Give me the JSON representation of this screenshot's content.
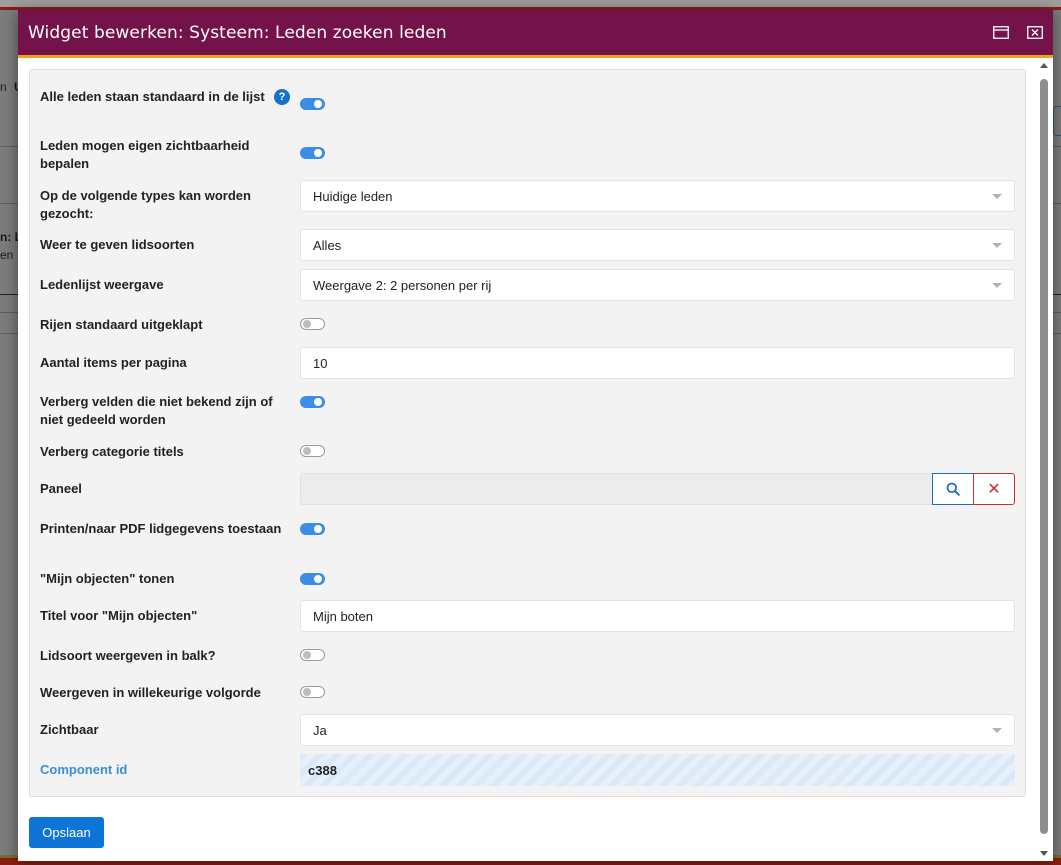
{
  "background": {
    "text_1": "n",
    "text_2": "U",
    "text_3": "n: L",
    "text_4": "en"
  },
  "modal": {
    "title": "Widget bewerken: Systeem: Leden zoeken leden",
    "maximize_icon": "window-maximize-icon",
    "close_icon": "window-close-icon"
  },
  "form": {
    "all_members_default": {
      "label": "Alle leden staan standaard in de lijst",
      "help": "?",
      "value": true
    },
    "members_own_visibility": {
      "label": "Leden mogen eigen zichtbaarheid bepalen",
      "value": true
    },
    "search_types": {
      "label": "Op de volgende types kan worden gezocht:",
      "value": "Huidige leden"
    },
    "member_types": {
      "label": "Weer te geven lidsoorten",
      "value": "Alles"
    },
    "list_view": {
      "label": "Ledenlijst weergave",
      "value": "Weergave 2: 2 personen per rij"
    },
    "rows_expanded": {
      "label": "Rijen standaard uitgeklapt",
      "value": false
    },
    "items_per_page": {
      "label": "Aantal items per pagina",
      "value": "10"
    },
    "hide_unknown_fields": {
      "label": "Verberg velden die niet bekend zijn of niet gedeeld worden",
      "value": true
    },
    "hide_category_titles": {
      "label": "Verberg categorie titels",
      "value": false
    },
    "panel": {
      "label": "Paneel",
      "value": ""
    },
    "print_pdf": {
      "label": "Printen/naar PDF lidgegevens toestaan",
      "value": true
    },
    "show_my_objects": {
      "label": "\"Mijn objecten\" tonen",
      "value": true
    },
    "my_objects_title": {
      "label": "Titel voor \"Mijn objecten\"",
      "value": "Mijn boten"
    },
    "member_type_in_bar": {
      "label": "Lidsoort weergeven in balk?",
      "value": false
    },
    "random_order": {
      "label": "Weergeven in willekeurige volgorde",
      "value": false
    },
    "visible": {
      "label": "Zichtbaar",
      "value": "Ja"
    },
    "component_id": {
      "label": "Component id",
      "value": "c388"
    }
  },
  "actions": {
    "save_label": "Opslaan",
    "clear_symbol": "✕"
  },
  "colors": {
    "header": "#74134a",
    "header_accent": "#f0a21a",
    "toggle_on": "#3c8de6",
    "primary_button": "#0f74d8",
    "danger": "#c9302c"
  }
}
